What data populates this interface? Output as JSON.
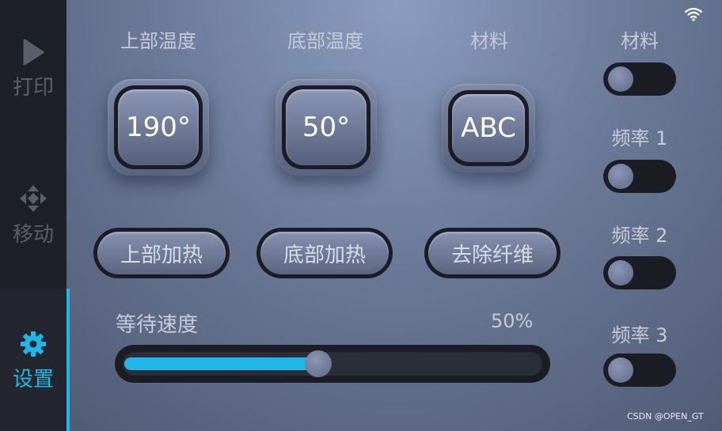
{
  "sidebar": {
    "items": [
      {
        "label": "打印",
        "icon": "play-icon",
        "active": false
      },
      {
        "label": "移动",
        "icon": "move-arrows-icon",
        "active": false
      },
      {
        "label": "设置",
        "icon": "gear-icon",
        "active": true
      }
    ]
  },
  "headings": {
    "top_temp": "上部温度",
    "bottom_temp": "底部温度",
    "material": "材料"
  },
  "knobs": {
    "top_temp_value": "190°",
    "bottom_temp_value": "50°",
    "material_value": "ABC"
  },
  "buttons": {
    "top_heat": "上部加热",
    "bottom_heat": "底部加热",
    "remove_fiber": "去除纤维"
  },
  "speed": {
    "label": "等待速度",
    "value_text": "50%",
    "value": 0.5
  },
  "toggles": [
    {
      "label": "材料",
      "on": false
    },
    {
      "label": "频率 1",
      "on": false
    },
    {
      "label": "频率 2",
      "on": false
    },
    {
      "label": "频率 3",
      "on": false
    }
  ],
  "status": {
    "wifi_icon": "wifi-icon"
  },
  "watermark": "CSDN @OPEN_GT",
  "colors": {
    "accent": "#1fb6e8",
    "sidebar_bg": "#1e2028",
    "inactive_text": "#5a5f6b"
  }
}
